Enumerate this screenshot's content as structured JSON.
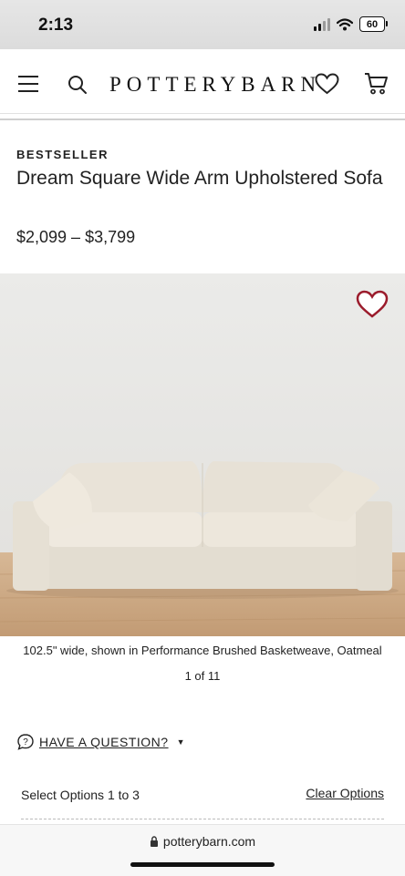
{
  "status_bar": {
    "time": "2:13",
    "battery": "60"
  },
  "header": {
    "logo": "POTTERYBARN"
  },
  "product": {
    "badge": "BESTSELLER",
    "title": "Dream Square Wide Arm Upholstered Sofa",
    "price": "$2,099 – $3,799",
    "image_caption": "102.5\" wide, shown in Performance Brushed Basketweave, Oatmeal",
    "image_counter": "1 of 11"
  },
  "question": {
    "label": "HAVE A QUESTION?"
  },
  "options": {
    "label": "Select Options 1 to 3",
    "clear": "Clear Options"
  },
  "browser": {
    "url": "potterybarn.com"
  },
  "colors": {
    "background": "#ffffff",
    "text": "#222222",
    "favorite": "#9b1c2c",
    "sofa": "#ece6db",
    "floor": "#c8a37e"
  },
  "icons": [
    "menu-icon",
    "search-icon",
    "heart-icon",
    "cart-icon",
    "favorite-heart-icon",
    "question-icon",
    "lock-icon"
  ]
}
